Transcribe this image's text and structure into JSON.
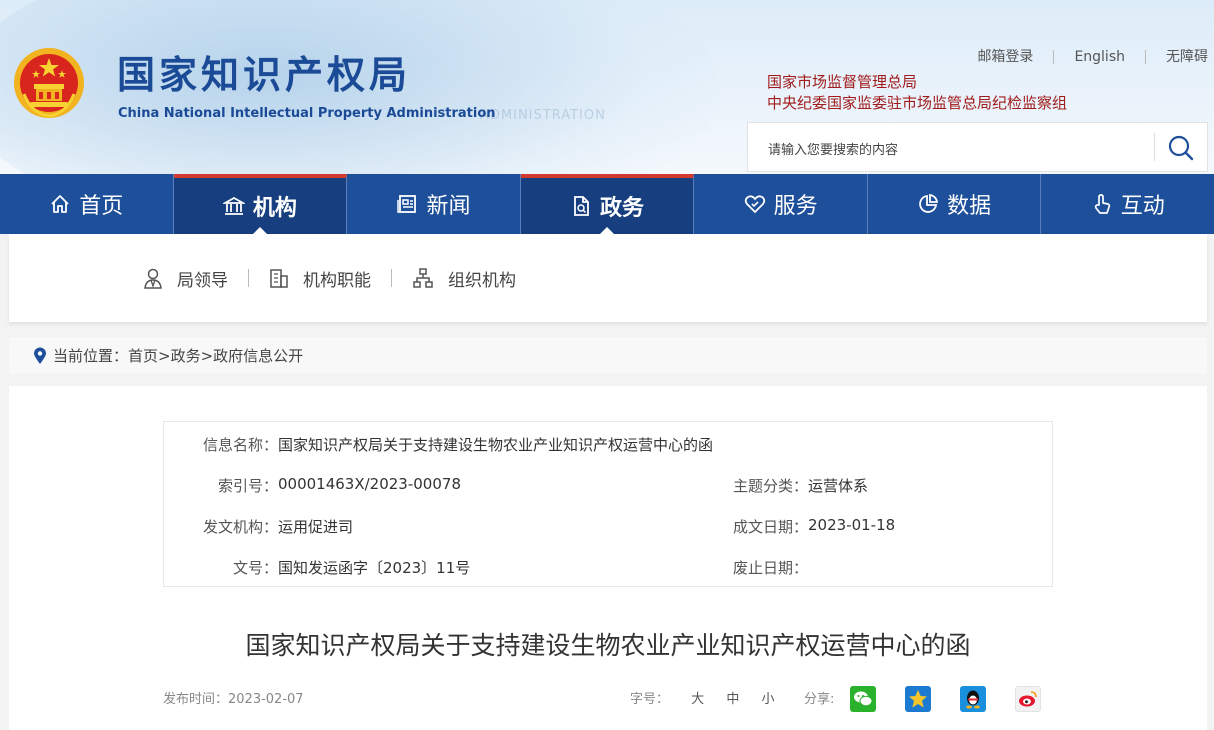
{
  "header": {
    "title_cn": "国家知识产权局",
    "title_en": "China National Intellectual Property Administration",
    "watermark": "ADMINISTRATION",
    "top_links": [
      "邮箱登录",
      "English",
      "无障碍"
    ],
    "org_links": [
      "国家市场监督管理总局",
      "中央纪委国家监委驻市场监管总局纪检监察组"
    ],
    "search_placeholder": "请输入您要搜索的内容"
  },
  "nav": [
    {
      "label": "首页",
      "icon": "home-icon",
      "active": false
    },
    {
      "label": "机构",
      "icon": "bank-icon",
      "active": true
    },
    {
      "label": "新闻",
      "icon": "newspaper-icon",
      "active": false
    },
    {
      "label": "政务",
      "icon": "document-icon",
      "active": true
    },
    {
      "label": "服务",
      "icon": "heart-hand-icon",
      "active": false
    },
    {
      "label": "数据",
      "icon": "pie-chart-icon",
      "active": false
    },
    {
      "label": "互动",
      "icon": "pointer-hand-icon",
      "active": false
    }
  ],
  "subnav": [
    {
      "label": "局领导",
      "icon": "person-icon"
    },
    {
      "label": "机构职能",
      "icon": "building-icon"
    },
    {
      "label": "组织机构",
      "icon": "org-chart-icon"
    }
  ],
  "breadcrumb": {
    "prefix": "当前位置：",
    "path": "首页>政务>政府信息公开"
  },
  "info": {
    "name_label": "信息名称：",
    "name_value": "国家知识产权局关于支持建设生物农业产业知识产权运营中心的函",
    "index_label": "索引号：",
    "index_value": "00001463X/2023-00078",
    "topic_label": "主题分类：",
    "topic_value": "运营体系",
    "issuer_label": "发文机构：",
    "issuer_value": "运用促进司",
    "date_label": "成文日期：",
    "date_value": "2023-01-18",
    "docno_label": "文号：",
    "docno_value": "国知发运函字〔2023〕11号",
    "expire_label": "废止日期：",
    "expire_value": ""
  },
  "article": {
    "title": "国家知识产权局关于支持建设生物农业产业知识产权运营中心的函",
    "publish_label": "发布时间：",
    "publish_date": "2023-02-07",
    "fontsize_label": "字号：",
    "fontsizes": [
      "大",
      "中",
      "小"
    ],
    "share_label": "分享:"
  },
  "colors": {
    "nav_bg": "#1e4f9a",
    "nav_active": "#173f7f",
    "accent_red": "#d23a31",
    "title_blue": "#1b4a96",
    "org_red": "#a01b1b"
  }
}
